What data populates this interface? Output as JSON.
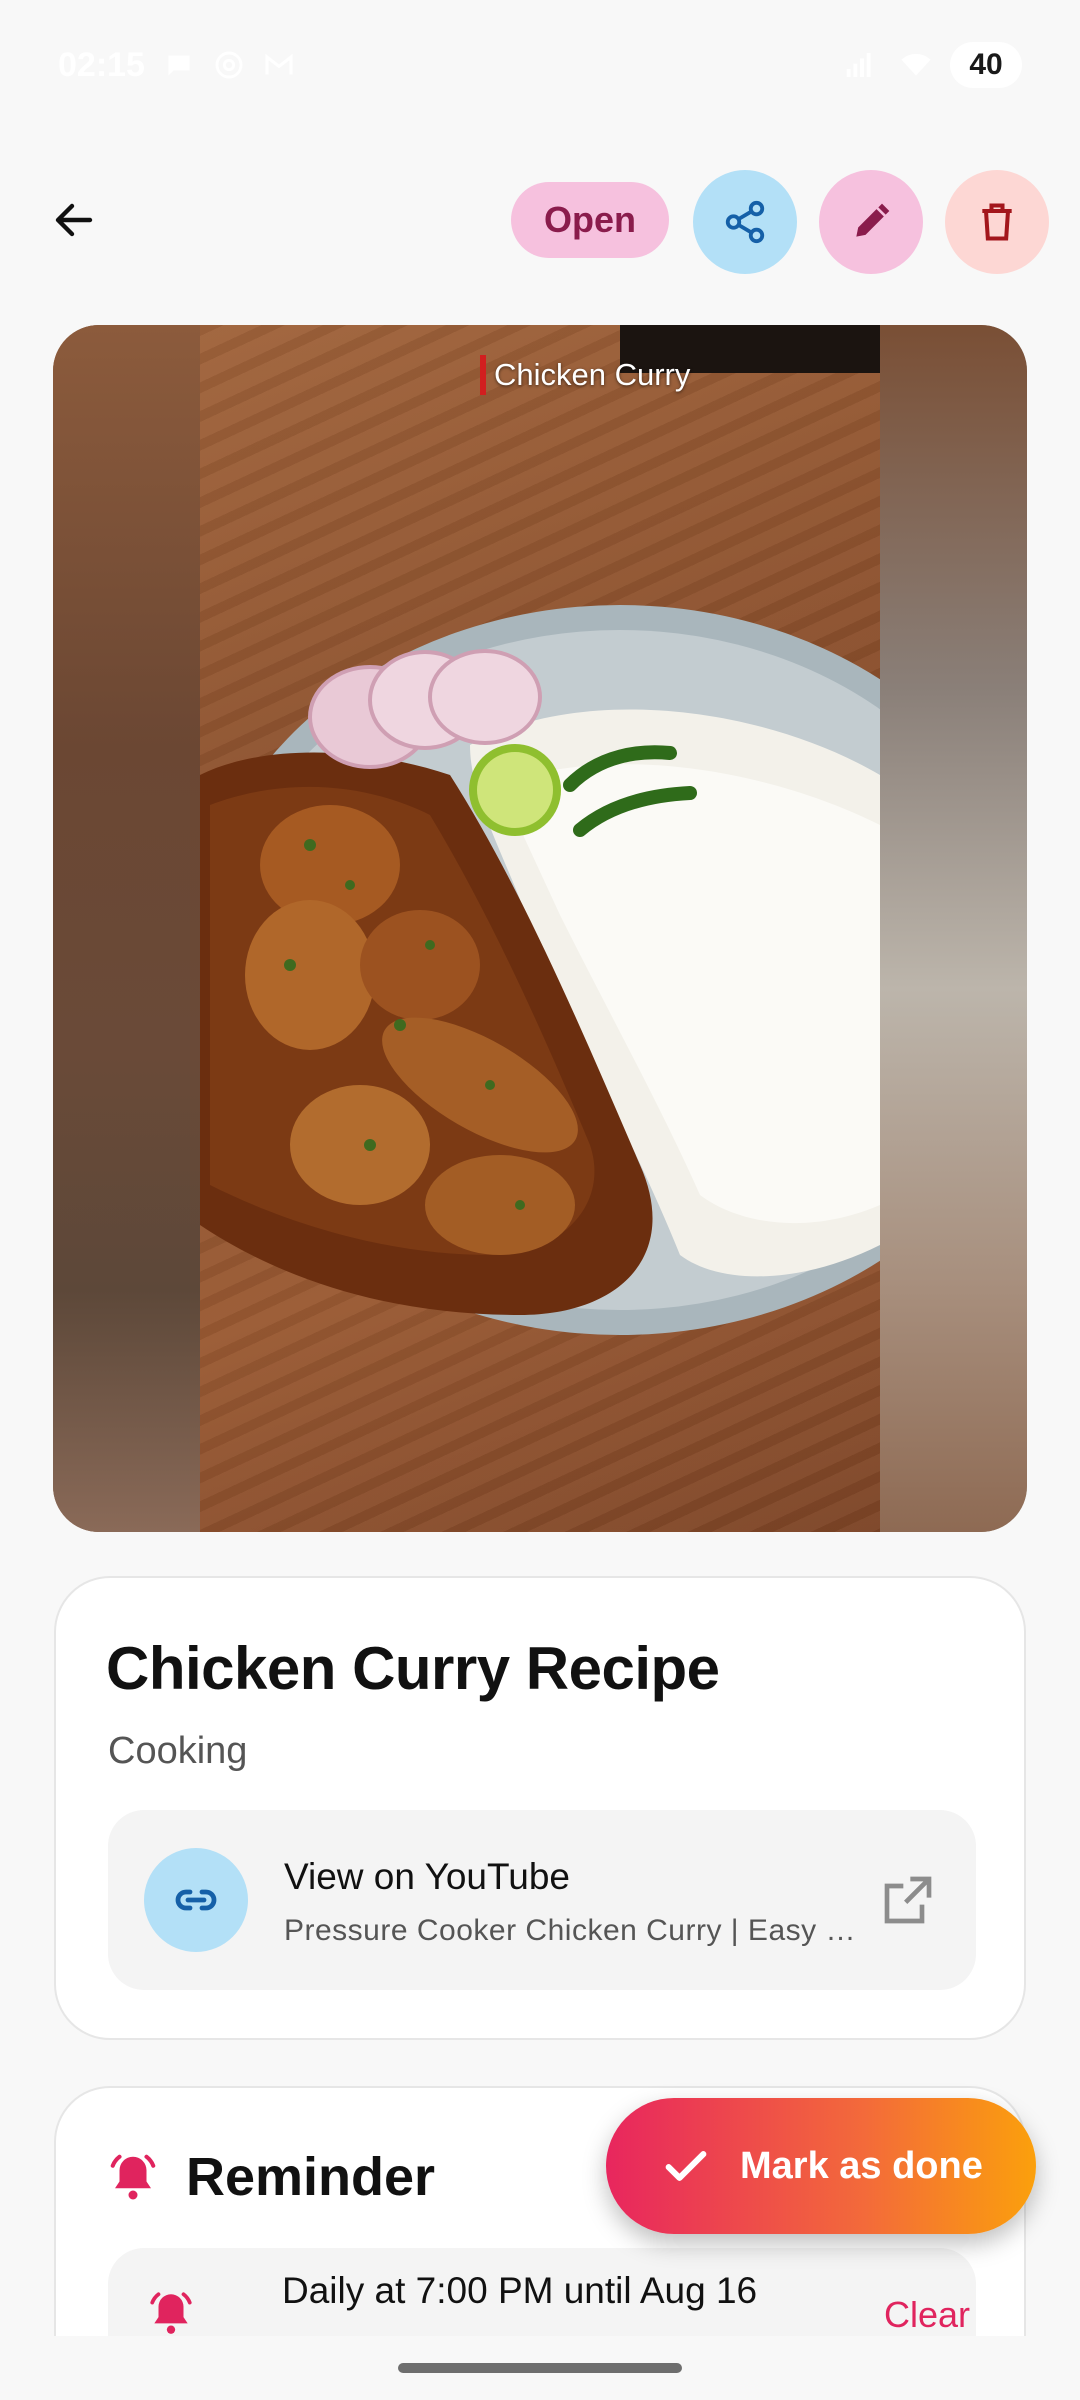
{
  "status_bar": {
    "time": "02:15",
    "battery": "40",
    "icons": [
      "chat-bubble-icon",
      "at-sign-icon",
      "gmail-icon",
      "signal-icon",
      "wifi-icon"
    ]
  },
  "top_bar": {
    "back_icon": "arrow-left-icon",
    "open_label": "Open",
    "share_icon": "share-icon",
    "edit_icon": "pencil-icon",
    "delete_icon": "trash-icon"
  },
  "hero": {
    "caption": "Chicken Curry"
  },
  "item": {
    "title": "Chicken Curry Recipe",
    "category": "Cooking",
    "link": {
      "title": "View on YouTube",
      "subtitle": "Pressure Cooker Chicken Curry | Easy Chicken Curry Recipe",
      "icon": "link-icon",
      "open_icon": "external-link-icon"
    }
  },
  "reminder": {
    "title": "Reminder",
    "icon": "bell-ring-icon",
    "schedule": "Daily at 7:00 PM until Aug 16",
    "clear_label": "Clear"
  },
  "fab": {
    "label": "Mark as done",
    "icon": "check-icon"
  },
  "colors": {
    "accent_pink": "#e0245e",
    "share_bg": "#b3e0f7",
    "open_bg": "#f6c1de",
    "delete_bg": "#fdd7d4",
    "fab_start": "#e8265e",
    "fab_end": "#fba00c"
  }
}
